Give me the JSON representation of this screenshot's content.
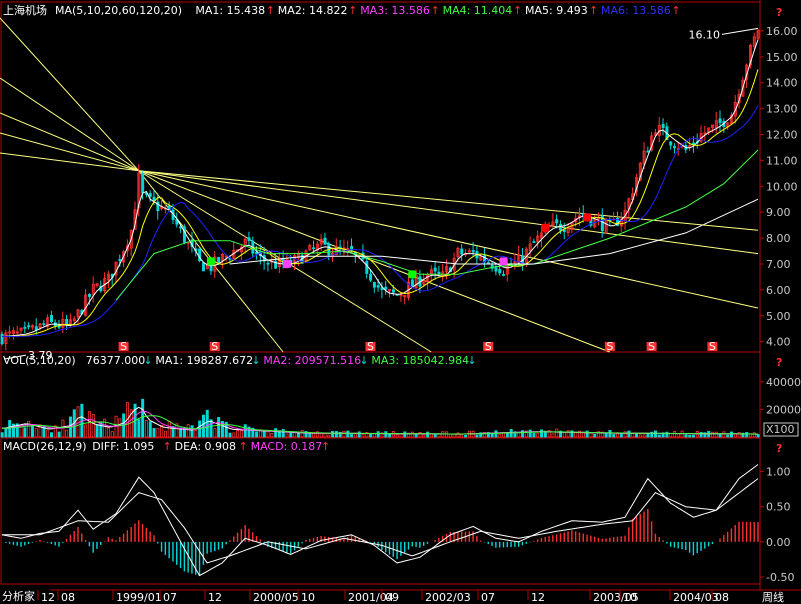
{
  "window": {
    "title": "上海机场",
    "period_label": "周线",
    "app_label": "分析家"
  },
  "colors": {
    "bg": "#000000",
    "frame": "#b40000",
    "up": "#ff3030",
    "down": "#00d8d8",
    "ma1": "#ffffff",
    "ma2": "#ffff00",
    "ma3": "#ff00ff",
    "ma4": "#00ff00",
    "ma5": "#ffffff",
    "ma6": "#2020ff",
    "fan": "#ffff80"
  },
  "help_mark": "?",
  "price_panel": {
    "header": [
      {
        "text": "MA(5,10,20,60,120,20)",
        "color": "#ffffff"
      },
      {
        "text": "MA1: 15.438",
        "color": "#ffffff"
      },
      {
        "text": "MA2: 14.822",
        "color": "#ffffff"
      },
      {
        "text": "MA3: 13.586",
        "color": "#ff40ff"
      },
      {
        "text": "MA4: 11.404",
        "color": "#40ff40"
      },
      {
        "text": "MA5: 9.493",
        "color": "#ffffff"
      },
      {
        "text": "MA6: 13.586",
        "color": "#3030ff"
      }
    ],
    "ticks": [
      "4.00",
      "5.00",
      "6.00",
      "7.00",
      "8.00",
      "9.00",
      "10.00",
      "11.00",
      "12.00",
      "13.00",
      "14.00",
      "15.00",
      "16.00"
    ],
    "high_label": "16.10",
    "low_label": "3.79",
    "event_marks": [
      "S",
      "S",
      "S",
      "S",
      "S",
      "S",
      "S"
    ]
  },
  "vol_panel": {
    "header": [
      {
        "text": "VOL(5,10,20)",
        "color": "#ffffff"
      },
      {
        "text": "76377.000",
        "color": "#ffffff"
      },
      {
        "text": "MA1: 198287.672",
        "color": "#ffffff"
      },
      {
        "text": "MA2: 209571.516",
        "color": "#ff40ff"
      },
      {
        "text": "MA3: 185042.984",
        "color": "#40ff40"
      }
    ],
    "ticks": [
      "20000",
      "40000"
    ],
    "unit": "X100"
  },
  "macd_panel": {
    "header": [
      {
        "text": "MACD(26,12,9)",
        "color": "#ffffff"
      },
      {
        "text": "DIFF: 1.095",
        "color": "#ffffff"
      },
      {
        "text": "DEA: 0.908",
        "color": "#ffffff"
      },
      {
        "text": "MACD: 0.187",
        "color": "#ff40ff"
      }
    ],
    "ticks": [
      "-0.50",
      "0.00",
      "0.50",
      "1.00"
    ]
  },
  "time_axis": [
    "12",
    "08",
    "1999/01",
    "07",
    "12",
    "2000/05",
    "10",
    "2001/04",
    "09",
    "2002/03",
    "07",
    "12",
    "2003/05",
    "10",
    "2004/03",
    "08"
  ],
  "chart_data": [
    {
      "type": "candlestick",
      "title": "上海机场",
      "ylim": [
        3.6,
        16.5
      ],
      "high": 16.1,
      "low": 3.79,
      "close_path": [
        {
          "x": 0,
          "y": 4.2
        },
        {
          "x": 6,
          "y": 4.3
        },
        {
          "x": 12,
          "y": 4.7
        },
        {
          "x": 18,
          "y": 4.6
        },
        {
          "x": 24,
          "y": 6.0
        },
        {
          "x": 28,
          "y": 6.4
        },
        {
          "x": 32,
          "y": 7.6
        },
        {
          "x": 34,
          "y": 8.3
        },
        {
          "x": 36,
          "y": 10.3
        },
        {
          "x": 37,
          "y": 9.6
        },
        {
          "x": 40,
          "y": 9.3
        },
        {
          "x": 44,
          "y": 9.0
        },
        {
          "x": 48,
          "y": 8.0
        },
        {
          "x": 52,
          "y": 7.0
        },
        {
          "x": 55,
          "y": 6.9
        },
        {
          "x": 60,
          "y": 7.4
        },
        {
          "x": 64,
          "y": 7.8
        },
        {
          "x": 68,
          "y": 7.2
        },
        {
          "x": 72,
          "y": 7.0
        },
        {
          "x": 76,
          "y": 7.0
        },
        {
          "x": 80,
          "y": 7.4
        },
        {
          "x": 84,
          "y": 7.7
        },
        {
          "x": 88,
          "y": 7.5
        },
        {
          "x": 92,
          "y": 7.4
        },
        {
          "x": 96,
          "y": 6.8
        },
        {
          "x": 100,
          "y": 5.9
        },
        {
          "x": 104,
          "y": 5.8
        },
        {
          "x": 108,
          "y": 6.2
        },
        {
          "x": 112,
          "y": 6.6
        },
        {
          "x": 116,
          "y": 6.5
        },
        {
          "x": 120,
          "y": 7.4
        },
        {
          "x": 124,
          "y": 7.4
        },
        {
          "x": 128,
          "y": 7.1
        },
        {
          "x": 132,
          "y": 6.8
        },
        {
          "x": 136,
          "y": 7.1
        },
        {
          "x": 140,
          "y": 7.8
        },
        {
          "x": 144,
          "y": 8.4
        },
        {
          "x": 148,
          "y": 8.5
        },
        {
          "x": 152,
          "y": 8.9
        },
        {
          "x": 156,
          "y": 8.7
        },
        {
          "x": 160,
          "y": 8.4
        },
        {
          "x": 164,
          "y": 9.0
        },
        {
          "x": 168,
          "y": 10.8
        },
        {
          "x": 172,
          "y": 12.3
        },
        {
          "x": 176,
          "y": 11.8
        },
        {
          "x": 180,
          "y": 11.4
        },
        {
          "x": 184,
          "y": 12.0
        },
        {
          "x": 188,
          "y": 12.3
        },
        {
          "x": 192,
          "y": 12.8
        },
        {
          "x": 196,
          "y": 14.8
        },
        {
          "x": 199,
          "y": 16.1
        }
      ],
      "ma_curves": [
        {
          "name": "MA4",
          "color": "#40ff40",
          "points": [
            {
              "x": 30,
              "y": 5.6
            },
            {
              "x": 40,
              "y": 7.4
            },
            {
              "x": 50,
              "y": 7.9
            },
            {
              "x": 60,
              "y": 7.9
            },
            {
              "x": 70,
              "y": 7.4
            },
            {
              "x": 80,
              "y": 7.4
            },
            {
              "x": 90,
              "y": 7.5
            },
            {
              "x": 100,
              "y": 7.1
            },
            {
              "x": 110,
              "y": 6.6
            },
            {
              "x": 120,
              "y": 6.6
            },
            {
              "x": 130,
              "y": 6.9
            },
            {
              "x": 140,
              "y": 7.0
            },
            {
              "x": 150,
              "y": 7.5
            },
            {
              "x": 160,
              "y": 8.0
            },
            {
              "x": 170,
              "y": 8.6
            },
            {
              "x": 180,
              "y": 9.2
            },
            {
              "x": 190,
              "y": 10.1
            },
            {
              "x": 199,
              "y": 11.4
            }
          ]
        },
        {
          "name": "MA5",
          "color": "#ffffff",
          "points": [
            {
              "x": 60,
              "y": 7.0
            },
            {
              "x": 80,
              "y": 7.3
            },
            {
              "x": 100,
              "y": 7.3
            },
            {
              "x": 120,
              "y": 7.0
            },
            {
              "x": 140,
              "y": 7.0
            },
            {
              "x": 160,
              "y": 7.4
            },
            {
              "x": 180,
              "y": 8.2
            },
            {
              "x": 199,
              "y": 9.5
            }
          ]
        }
      ],
      "signal_dots": [
        {
          "x": 55,
          "y": 7.1,
          "color": "#00ff00"
        },
        {
          "x": 75,
          "y": 7.0,
          "color": "#ff40ff"
        },
        {
          "x": 108,
          "y": 6.6,
          "color": "#00ff00"
        },
        {
          "x": 132,
          "y": 7.1,
          "color": "#ff40ff"
        },
        {
          "x": 143,
          "y": 8.4,
          "color": "#ff0000"
        },
        {
          "x": 154,
          "y": 8.8,
          "color": "#ff0000"
        }
      ],
      "fan_origin": {
        "x": 36,
        "y": 10.6
      },
      "fan_targets": [
        {
          "x": 199,
          "y": 8.3
        },
        {
          "x": 199,
          "y": 7.4
        },
        {
          "x": 199,
          "y": 5.3
        },
        {
          "x": 160,
          "y": 3.6
        },
        {
          "x": 113,
          "y": 3.6
        },
        {
          "x": 74,
          "y": 3.6
        }
      ]
    },
    {
      "type": "bar",
      "title": "VOL(5,10,20)",
      "ylim": [
        0,
        50000
      ],
      "envelope": [
        {
          "x": 0,
          "y": 9000
        },
        {
          "x": 6,
          "y": 14000
        },
        {
          "x": 12,
          "y": 8000
        },
        {
          "x": 18,
          "y": 12000
        },
        {
          "x": 20,
          "y": 22000
        },
        {
          "x": 24,
          "y": 13000
        },
        {
          "x": 28,
          "y": 10000
        },
        {
          "x": 32,
          "y": 15000
        },
        {
          "x": 34,
          "y": 27000
        },
        {
          "x": 36,
          "y": 32000
        },
        {
          "x": 38,
          "y": 18000
        },
        {
          "x": 42,
          "y": 10000
        },
        {
          "x": 50,
          "y": 7000
        },
        {
          "x": 54,
          "y": 17000
        },
        {
          "x": 60,
          "y": 8000
        },
        {
          "x": 80,
          "y": 4000
        },
        {
          "x": 100,
          "y": 3500
        },
        {
          "x": 120,
          "y": 3000
        },
        {
          "x": 140,
          "y": 5500
        },
        {
          "x": 160,
          "y": 4000
        },
        {
          "x": 180,
          "y": 3500
        },
        {
          "x": 199,
          "y": 3000
        }
      ]
    },
    {
      "type": "line",
      "title": "MACD(26,12,9)",
      "ylim": [
        -0.6,
        1.25
      ],
      "series": [
        {
          "name": "DIFF",
          "points": [
            {
              "x": 0,
              "y": 0.1
            },
            {
              "x": 5,
              "y": 0.05
            },
            {
              "x": 10,
              "y": 0.12
            },
            {
              "x": 15,
              "y": 0.15
            },
            {
              "x": 20,
              "y": 0.45
            },
            {
              "x": 24,
              "y": 0.18
            },
            {
              "x": 30,
              "y": 0.4
            },
            {
              "x": 36,
              "y": 0.92
            },
            {
              "x": 40,
              "y": 0.7
            },
            {
              "x": 44,
              "y": 0.3
            },
            {
              "x": 48,
              "y": -0.1
            },
            {
              "x": 52,
              "y": -0.48
            },
            {
              "x": 58,
              "y": -0.3
            },
            {
              "x": 64,
              "y": 0.05
            },
            {
              "x": 70,
              "y": -0.05
            },
            {
              "x": 76,
              "y": -0.18
            },
            {
              "x": 84,
              "y": 0.02
            },
            {
              "x": 92,
              "y": 0.1
            },
            {
              "x": 98,
              "y": -0.05
            },
            {
              "x": 104,
              "y": -0.3
            },
            {
              "x": 110,
              "y": -0.22
            },
            {
              "x": 118,
              "y": 0.1
            },
            {
              "x": 124,
              "y": 0.22
            },
            {
              "x": 130,
              "y": 0.05
            },
            {
              "x": 136,
              "y": 0.0
            },
            {
              "x": 142,
              "y": 0.15
            },
            {
              "x": 150,
              "y": 0.3
            },
            {
              "x": 158,
              "y": 0.28
            },
            {
              "x": 164,
              "y": 0.35
            },
            {
              "x": 170,
              "y": 0.9
            },
            {
              "x": 176,
              "y": 0.55
            },
            {
              "x": 182,
              "y": 0.35
            },
            {
              "x": 188,
              "y": 0.45
            },
            {
              "x": 194,
              "y": 0.9
            },
            {
              "x": 199,
              "y": 1.1
            }
          ]
        },
        {
          "name": "DEA",
          "points": [
            {
              "x": 0,
              "y": 0.1
            },
            {
              "x": 10,
              "y": 0.1
            },
            {
              "x": 20,
              "y": 0.3
            },
            {
              "x": 28,
              "y": 0.28
            },
            {
              "x": 36,
              "y": 0.7
            },
            {
              "x": 42,
              "y": 0.6
            },
            {
              "x": 48,
              "y": 0.2
            },
            {
              "x": 54,
              "y": -0.3
            },
            {
              "x": 60,
              "y": -0.2
            },
            {
              "x": 70,
              "y": 0.0
            },
            {
              "x": 80,
              "y": -0.1
            },
            {
              "x": 90,
              "y": 0.05
            },
            {
              "x": 100,
              "y": -0.05
            },
            {
              "x": 108,
              "y": -0.2
            },
            {
              "x": 118,
              "y": 0.0
            },
            {
              "x": 126,
              "y": 0.15
            },
            {
              "x": 136,
              "y": 0.05
            },
            {
              "x": 146,
              "y": 0.15
            },
            {
              "x": 158,
              "y": 0.25
            },
            {
              "x": 166,
              "y": 0.3
            },
            {
              "x": 172,
              "y": 0.7
            },
            {
              "x": 180,
              "y": 0.5
            },
            {
              "x": 188,
              "y": 0.45
            },
            {
              "x": 199,
              "y": 0.9
            }
          ]
        }
      ]
    }
  ]
}
